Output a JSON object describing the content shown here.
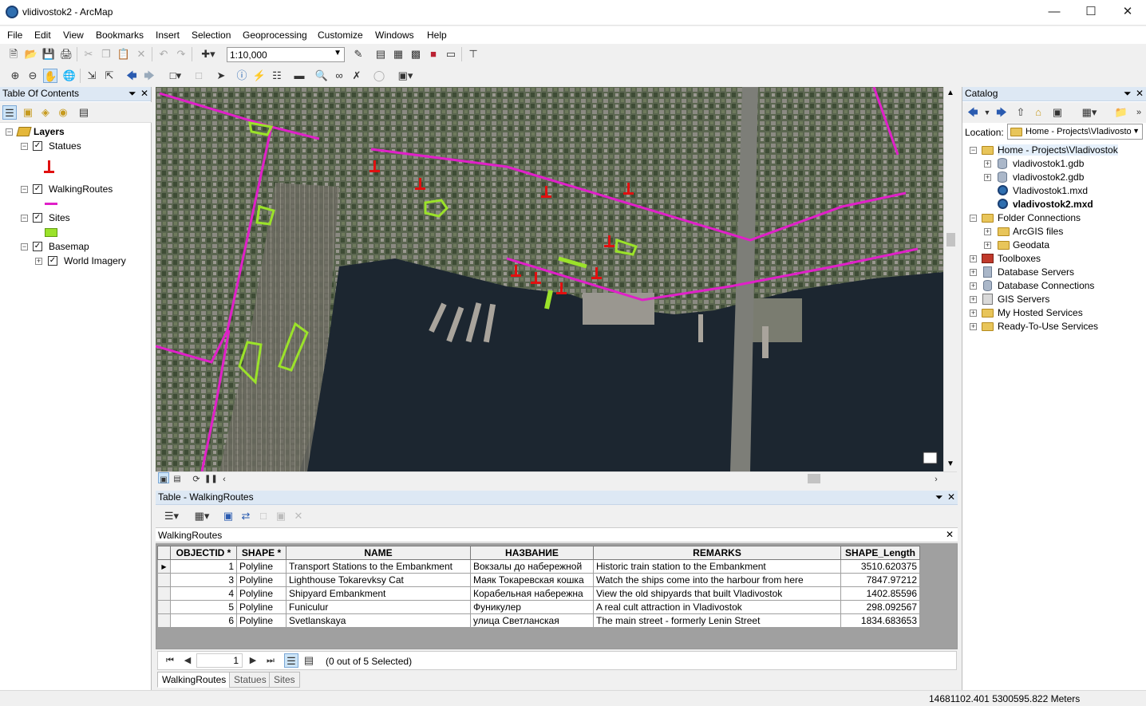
{
  "window": {
    "title": "vlidivostok2 - ArcMap"
  },
  "menu": [
    "File",
    "Edit",
    "View",
    "Bookmarks",
    "Insert",
    "Selection",
    "Geoprocessing",
    "Customize",
    "Windows",
    "Help"
  ],
  "toolbar": {
    "scale": "1:10,000"
  },
  "toc": {
    "title": "Table Of Contents",
    "root": "Layers",
    "layers": [
      {
        "label": "Statues",
        "checked": true
      },
      {
        "label": "WalkingRoutes",
        "checked": true
      },
      {
        "label": "Sites",
        "checked": true
      },
      {
        "label": "Basemap",
        "checked": true
      },
      {
        "label": "World Imagery",
        "checked": true
      }
    ]
  },
  "catalog": {
    "title": "Catalog",
    "location_label": "Location:",
    "location_value": "Home - Projects\\Vladivosto",
    "items": [
      {
        "label": "Home - Projects\\Vladivostok"
      },
      {
        "label": "vladivostok1.gdb"
      },
      {
        "label": "vladivostok2.gdb"
      },
      {
        "label": "Vladivostok1.mxd"
      },
      {
        "label": "vladivostok2.mxd"
      },
      {
        "label": "Folder Connections"
      },
      {
        "label": "ArcGIS files"
      },
      {
        "label": "Geodata"
      },
      {
        "label": "Toolboxes"
      },
      {
        "label": "Database Servers"
      },
      {
        "label": "Database Connections"
      },
      {
        "label": "GIS Servers"
      },
      {
        "label": "My Hosted Services"
      },
      {
        "label": "Ready-To-Use Services"
      }
    ]
  },
  "table": {
    "window_title": "Table - WalkingRoutes",
    "layer_title": "WalkingRoutes",
    "columns": [
      "OBJECTID *",
      "SHAPE *",
      "NAME",
      "НАЗВАНИЕ",
      "REMARKS",
      "SHAPE_Length"
    ],
    "rows": [
      [
        "1",
        "Polyline",
        "Transport Stations to the Embankment",
        "Вокзалы до набережной",
        "Historic train station to the Embankment",
        "3510.620375"
      ],
      [
        "3",
        "Polyline",
        "Lighthouse Tokarevksy Cat",
        "Маяк Токаревская кошка",
        "Watch the ships come into the harbour from here",
        "7847.97212"
      ],
      [
        "4",
        "Polyline",
        "Shipyard Embankment",
        "Корабельная набережна",
        "View the old shipyards that built Vladivostok",
        "1402.85596"
      ],
      [
        "5",
        "Polyline",
        "Funiculur",
        "Фуникулер",
        "A real cult attraction in Vladivostok",
        "298.092567"
      ],
      [
        "6",
        "Polyline",
        "Svetlanskaya",
        "улица Светланская",
        "The main street - formerly Lenin Street",
        "1834.683653"
      ]
    ],
    "nav_record": "1",
    "selection_status": "(0 out of 5 Selected)",
    "tabs": [
      "WalkingRoutes",
      "Statues",
      "Sites"
    ]
  },
  "status": {
    "coordinates": "14681102.401  5300595.822 Meters"
  },
  "colors": {
    "route": "#e020c8",
    "site": "#9be22a",
    "statue": "#e01010",
    "water": "#1c2630"
  }
}
